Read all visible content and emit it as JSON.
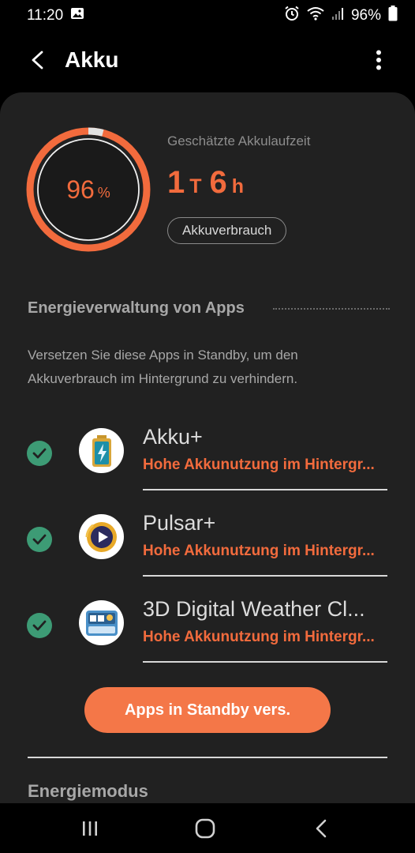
{
  "status_bar": {
    "time": "11:20",
    "battery_percent": "96%"
  },
  "app_bar": {
    "title": "Akku"
  },
  "battery": {
    "level_percent": 96,
    "level_number": "96",
    "level_unit": "%",
    "estimate_label": "Geschätzte Akkulaufzeit",
    "estimate_days": "1",
    "estimate_days_unit": "T",
    "estimate_hours": "6",
    "estimate_hours_unit": "h",
    "usage_button": "Akkuverbrauch"
  },
  "power_management": {
    "title": "Energieverwaltung von Apps",
    "description": "Versetzen Sie diese Apps in Standby, um den Akkuverbrauch im Hintergrund zu verhindern.",
    "apps": [
      {
        "name": "Akku+",
        "status": "Hohe Akkunutzung im Hintergr..."
      },
      {
        "name": "Pulsar+",
        "status": "Hohe Akkunutzung im Hintergr..."
      },
      {
        "name": "3D Digital Weather Cl...",
        "status": "Hohe Akkunutzung im Hintergr..."
      }
    ],
    "standby_button": "Apps in Standby vers."
  },
  "next_section": {
    "title": "Energiemodus"
  },
  "colors": {
    "accent": "#f26b3d",
    "check": "#3d9b75",
    "card": "#212121"
  }
}
